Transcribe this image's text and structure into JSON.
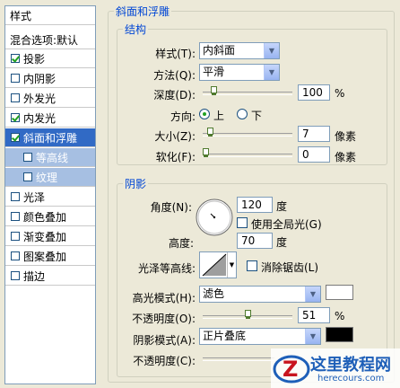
{
  "styles_list": {
    "header": "样式",
    "blending": "混合选项:默认",
    "items": [
      {
        "label": "投影",
        "checked": true
      },
      {
        "label": "内阴影",
        "checked": false
      },
      {
        "label": "外发光",
        "checked": false
      },
      {
        "label": "内发光",
        "checked": true
      },
      {
        "label": "斜面和浮雕",
        "checked": true,
        "selected": true
      },
      {
        "label": "等高线",
        "checked": false,
        "sub": true
      },
      {
        "label": "纹理",
        "checked": false,
        "sub": true
      },
      {
        "label": "光泽",
        "checked": false
      },
      {
        "label": "颜色叠加",
        "checked": false
      },
      {
        "label": "渐变叠加",
        "checked": false
      },
      {
        "label": "图案叠加",
        "checked": false
      },
      {
        "label": "描边",
        "checked": false
      }
    ]
  },
  "bevel": {
    "title": "斜面和浮雕",
    "structure": {
      "title": "结构",
      "style_label": "样式(T):",
      "style_value": "内斜面",
      "technique_label": "方法(Q):",
      "technique_value": "平滑",
      "depth_label": "深度(D):",
      "depth_value": "100",
      "depth_unit": "%",
      "depth_fraction": 0.1,
      "direction_label": "方向:",
      "direction_up": "上",
      "direction_down": "下",
      "direction_selected": "up",
      "size_label": "大小(Z):",
      "size_value": "7",
      "size_unit": "像素",
      "size_fraction": 0.05,
      "soften_label": "软化(F):",
      "soften_value": "0",
      "soften_unit": "像素",
      "soften_fraction": 0
    },
    "shading": {
      "title": "阴影",
      "angle_label": "角度(N):",
      "angle_value": "120",
      "angle_unit": "度",
      "global_light_label": "使用全局光(G)",
      "altitude_label": "高度:",
      "altitude_value": "70",
      "altitude_unit": "度",
      "gloss_label": "光泽等高线:",
      "antialias_label": "消除锯齿(L)",
      "highlight_mode_label": "高光模式(H):",
      "highlight_mode_value": "滤色",
      "highlight_color": "#ffffff",
      "highlight_opacity_label": "不透明度(O):",
      "highlight_opacity_value": "51",
      "highlight_opacity_unit": "%",
      "highlight_opacity_fraction": 0.51,
      "shadow_mode_label": "阴影模式(A):",
      "shadow_mode_value": "正片叠底",
      "shadow_color": "#000000",
      "shadow_opacity_label": "不透明度(C):"
    }
  },
  "watermark": {
    "title": "这里教程网",
    "url": "herecours.com"
  }
}
